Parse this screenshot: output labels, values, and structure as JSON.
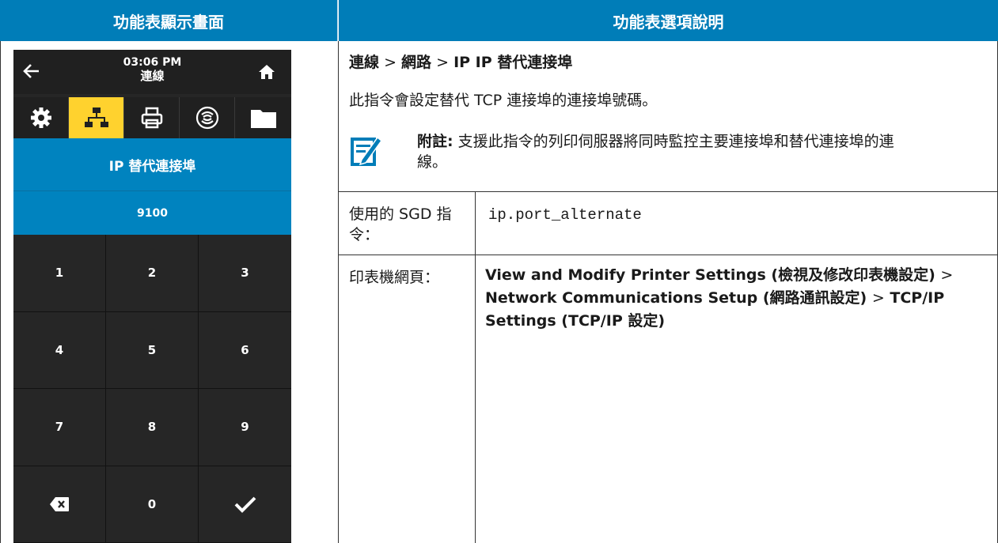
{
  "header": {
    "left": "功能表顯示畫面",
    "right": "功能表選項說明"
  },
  "device": {
    "time": "03:06 PM",
    "menu_name": "連線",
    "tabs": [
      "gear-icon",
      "network-icon",
      "printer-icon",
      "wireless-icon",
      "folder-icon"
    ],
    "active_tab": 1,
    "field_title": "IP 替代連接埠",
    "field_value": "9100",
    "keys": [
      "1",
      "2",
      "3",
      "4",
      "5",
      "6",
      "7",
      "8",
      "9",
      "backspace-icon",
      "0",
      "checkmark-icon"
    ],
    "colors": {
      "accent": "#ffd22e",
      "field_bg": "#0083bf",
      "keypad_bg": "#262626"
    }
  },
  "description": {
    "breadcrumb": [
      "連線",
      "網路",
      "IP IP 替代連接埠"
    ],
    "breadcrumb_separator": ">",
    "text": "此指令會設定替代 TCP 連接埠的連接埠號碼。",
    "note_label": "附註:",
    "note_text": "支援此指令的列印伺服器將同時監控主要連接埠和替代連接埠的連線。"
  },
  "sgd": {
    "label": "使用的 SGD 指令：",
    "value": "ip.port_alternate"
  },
  "web": {
    "label": "印表機網頁：",
    "path": [
      "View and Modify Printer Settings (檢視及修改印表機設定)",
      "Network Communications Setup (網路通訊設定)",
      "TCP/IP Settings (TCP/IP 設定)"
    ],
    "separator": ">"
  },
  "colors": {
    "header_bg": "#007db8",
    "header_text": "#ffffff"
  }
}
